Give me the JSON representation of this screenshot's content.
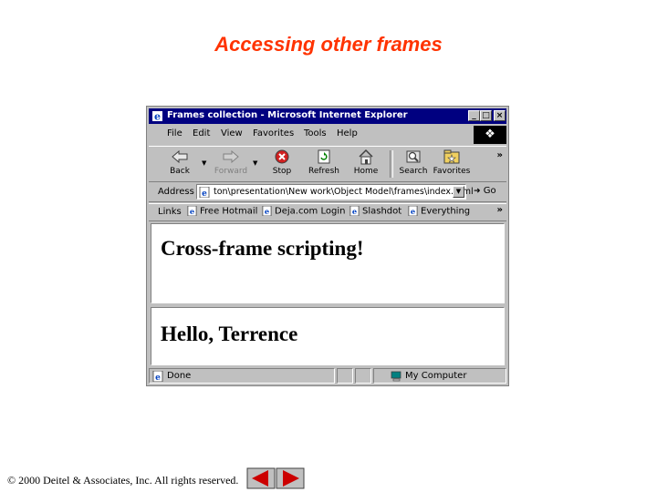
{
  "slide": {
    "title": "Accessing other frames",
    "footer": "© 2000 Deitel & Associates, Inc.  All rights reserved."
  },
  "window": {
    "title": "Frames collection - Microsoft Internet Explorer",
    "controls": [
      "minimize",
      "maximize",
      "close"
    ],
    "logo_icon": "windows-flag-icon"
  },
  "menu": {
    "items": [
      "File",
      "Edit",
      "View",
      "Favorites",
      "Tools",
      "Help"
    ]
  },
  "toolbar": {
    "buttons": [
      {
        "label": "Back",
        "icon": "back-arrow-icon",
        "enabled": true
      },
      {
        "label": "Forward",
        "icon": "forward-arrow-icon",
        "enabled": false
      },
      {
        "label": "Stop",
        "icon": "stop-icon",
        "enabled": true
      },
      {
        "label": "Refresh",
        "icon": "refresh-icon",
        "enabled": true
      },
      {
        "label": "Home",
        "icon": "home-icon",
        "enabled": true
      },
      {
        "label": "Search",
        "icon": "search-icon",
        "enabled": true
      },
      {
        "label": "Favorites",
        "icon": "favorites-icon",
        "enabled": true
      }
    ],
    "more": "»"
  },
  "address": {
    "label": "Address",
    "value": "ton\\presentation\\New work\\Object Model\\frames\\index.html",
    "go_label": "Go"
  },
  "links": {
    "label": "Links",
    "items": [
      "Free Hotmail",
      "Deja.com Login",
      "Slashdot",
      "Everything"
    ],
    "more": "»"
  },
  "content": {
    "top_frame_heading": "Cross-frame scripting!",
    "bottom_frame_heading": "Hello, Terrence"
  },
  "status": {
    "text": "Done",
    "zone": "My Computer"
  },
  "colors": {
    "title_accent": "#ff3300",
    "titlebar": "#000080",
    "chrome": "#c0c0c0",
    "nav_arrow": "#cc0000"
  }
}
